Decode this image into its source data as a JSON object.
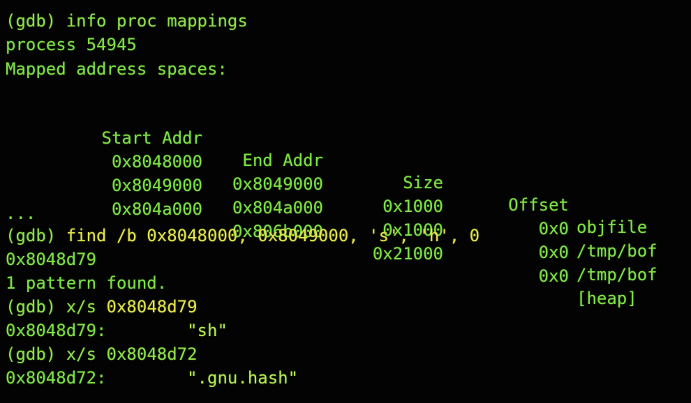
{
  "colors": {
    "background": "#020302",
    "text_green": "#7ee043",
    "command_yellow": "#e2e34a"
  },
  "lines": {
    "cmd_info_prompt": "(gdb)",
    "cmd_info_text": "info proc mappings",
    "process": "process 54945",
    "mapped": "Mapped address spaces:",
    "ellipsis": "...",
    "find_prompt": "(gdb)",
    "find_text": "find /b 0x8048000, 0x8049000, 's', 'h', 0",
    "find_result_addr": "0x8048d79",
    "pattern_found": "1 pattern found.",
    "xs1_prompt": "(gdb)",
    "xs1_cmd": "x/s",
    "xs1_addr": "0x8048d79",
    "xs1_result_addr": "0x8048d79:",
    "xs1_result_value": "\"sh\"",
    "xs2_prompt": "(gdb)",
    "xs2_cmd": "x/s",
    "xs2_addr": "0x8048d72",
    "xs2_result_addr": "0x8048d72:",
    "xs2_result_value": "\".gnu.hash\""
  },
  "mappings": {
    "headers": {
      "start": "Start Addr",
      "end": "End Addr",
      "size": "Size",
      "offset": "Offset",
      "objfile": "objfile"
    },
    "rows": [
      {
        "start": "0x8048000",
        "end": "0x8049000",
        "size": "0x1000",
        "offset": "0x0",
        "objfile": "/tmp/bof"
      },
      {
        "start": "0x8049000",
        "end": "0x804a000",
        "size": "0x1000",
        "offset": "0x0",
        "objfile": "/tmp/bof"
      },
      {
        "start": "0x804a000",
        "end": "0x806b000",
        "size": "0x21000",
        "offset": "0x0",
        "objfile": "[heap]"
      }
    ]
  }
}
